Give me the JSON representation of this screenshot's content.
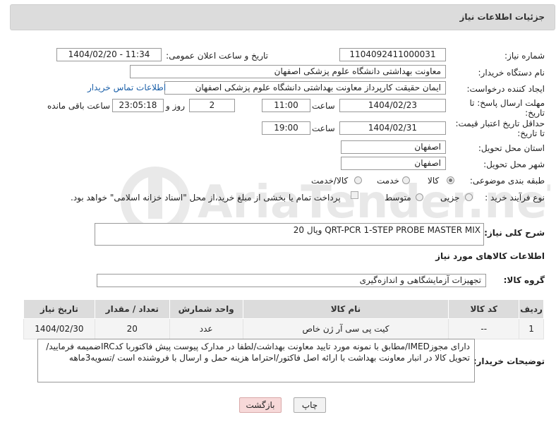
{
  "header": {
    "title": "جزئیات اطلاعات نیاز"
  },
  "form": {
    "need_number_label": "شماره نیاز:",
    "need_number": "1104092411000031",
    "announce_label": "تاریخ و ساعت اعلان عمومی:",
    "announce_value": "1404/02/20 - 11:34",
    "buyer_org_label": "نام دستگاه خریدار:",
    "buyer_org": "معاونت بهداشتی دانشگاه علوم پزشکی اصفهان",
    "creator_label": "ایجاد کننده درخواست:",
    "creator": "ایمان حقیقت کارپرداز معاونت بهداشتی دانشگاه علوم پزشکی اصفهان",
    "contact_link": "اطلاعات تماس خریدار",
    "deadline_label_line1": "مهلت ارسال پاسخ: تا",
    "deadline_label_line2": "تاریخ:",
    "deadline_date": "1404/02/23",
    "time_label": "ساعت",
    "deadline_time": "11:00",
    "days_value": "2",
    "days_label": "روز و",
    "remaining_time": "23:05:18",
    "remaining_label": "ساعت باقی مانده",
    "validity_label_line1": "حداقل تاریخ اعتبار قیمت:",
    "validity_label_line2": "تا تاریخ:",
    "validity_date": "1404/02/31",
    "validity_time": "19:00",
    "province_label": "استان محل تحویل:",
    "province": "اصفهان",
    "city_label": "شهر محل تحویل:",
    "city": "اصفهان",
    "category_label": "طبقه بندی موضوعی:",
    "category_options": [
      "کالا",
      "خدمت",
      "کالا/خدمت"
    ],
    "process_label": "نوع فرآیند خرید :",
    "process_options": [
      "جزیی",
      "متوسط"
    ],
    "payment_note": "پرداخت تمام یا بخشی از مبلغ خرید،از محل \"اسناد خزانه اسلامی\" خواهد بود."
  },
  "description": {
    "label": "شرح کلی نیاز:",
    "value": "20 ویال QRT-PCR 1-STEP PROBE MASTER MIX"
  },
  "items_section": {
    "title": "اطلاعات کالاهای مورد نیاز",
    "group_label": "گروه کالا:",
    "group_value": "تجهیزات آزمایشگاهی و اندازه‌گیری",
    "columns": [
      "ردیف",
      "کد کالا",
      "نام کالا",
      "واحد شمارش",
      "تعداد / مقدار",
      "تاریخ نیاز"
    ],
    "rows": [
      {
        "row": "1",
        "code": "--",
        "name": "کیت پی سی آر ژن خاص",
        "unit": "عدد",
        "qty": "20",
        "date": "1404/02/30"
      }
    ]
  },
  "buyer_notes": {
    "label": "توضیحات خریدار:",
    "value": "دارای مجوزIMED/مطابق با نمونه مورد تایید معاونت بهداشت/لطفا در مدارک پیوست پیش فاکتوربا کدIRCضمیمه فرمایید/تحویل کالا در انبار معاونت بهداشت با ارائه اصل فاکتور/احتراما هزینه حمل و ارسال با فروشنده است /تسویه3ماهه"
  },
  "buttons": {
    "print": "چاپ",
    "back": "بازگشت"
  },
  "watermark": {
    "text": "AriaTender.neT"
  },
  "colors": {
    "header_bg": "#dcdcdc",
    "link": "#1a5fa8",
    "back_button_bg": "#f7d9d9"
  }
}
